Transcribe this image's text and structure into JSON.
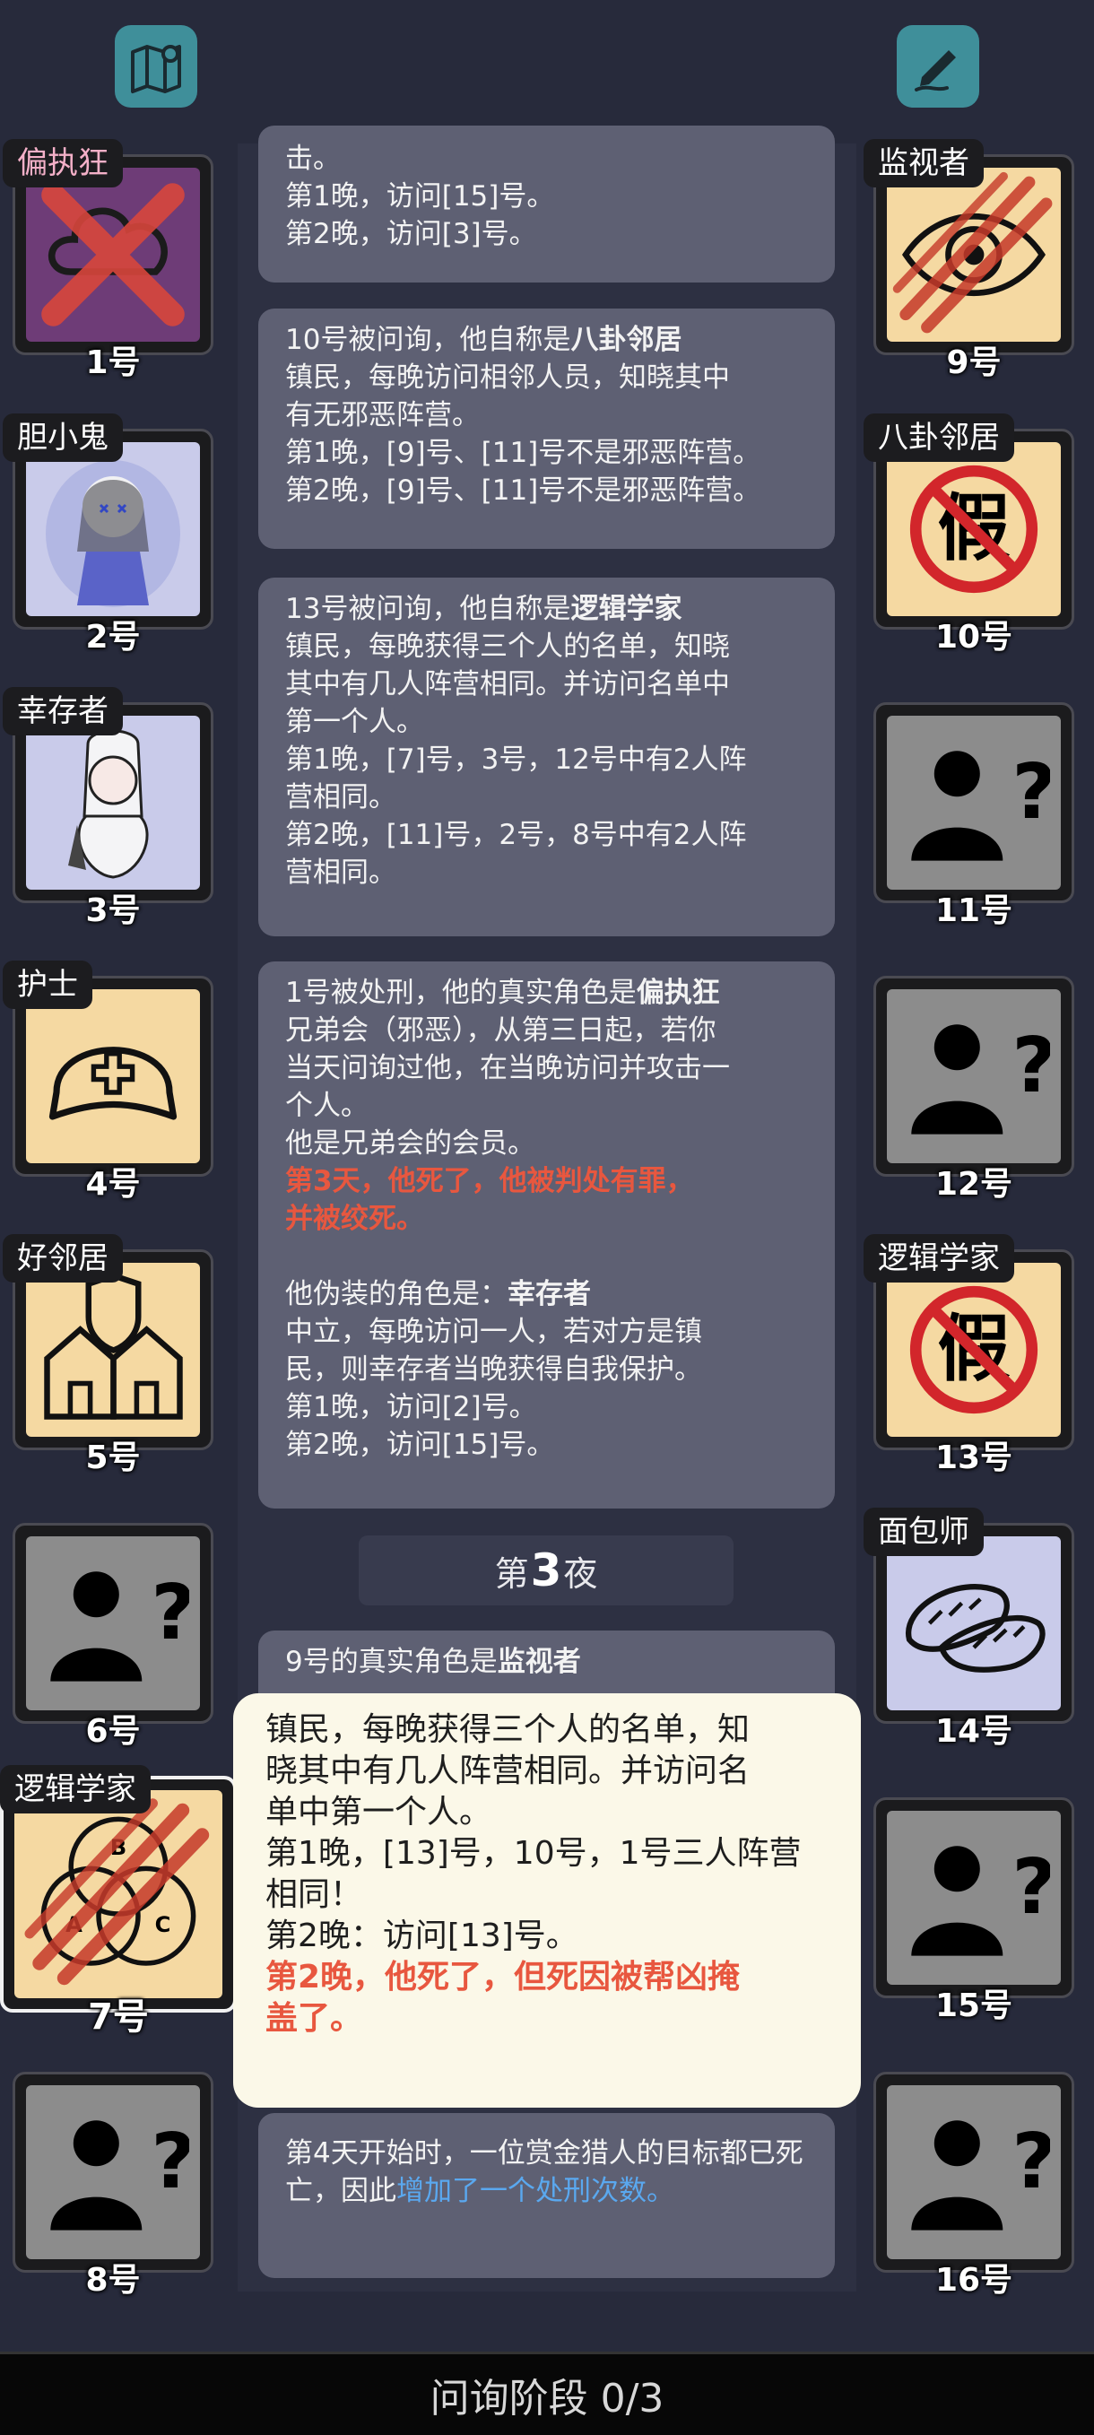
{
  "toolbar": {
    "map_icon": "map-icon",
    "notes_icon": "pen-note-icon"
  },
  "messages": {
    "m0": {
      "lines": [
        "击。",
        "第1晚，访问[15]号。",
        "第2晚，访问[3]号。"
      ]
    },
    "m1": {
      "prefix": "10号被问询，他自称是",
      "role": "八卦邻居",
      "lines": [
        "镇民，每晚访问相邻人员，知晓其中",
        "有无邪恶阵营。",
        "第1晚，[9]号、[11]号不是邪恶阵营。",
        "第2晚，[9]号、[11]号不是邪恶阵营。"
      ]
    },
    "m2": {
      "prefix": "13号被问询，他自称是",
      "role": "逻辑学家",
      "lines": [
        "镇民，每晚获得三个人的名单，知晓",
        "其中有几人阵营相同。并访问名单中",
        "第一个人。",
        "第1晚，[7]号，3号，12号中有2人阵",
        "营相同。",
        "第2晚，[11]号，2号，8号中有2人阵",
        "营相同。"
      ]
    },
    "m3": {
      "prefix": "1号被处刑，他的真实角色是",
      "role": "偏执狂",
      "lines": [
        "兄弟会（邪恶），从第三日起，若你",
        "当天问询过他，在当晚访问并攻击一",
        "个人。",
        "他是兄弟会的会员。"
      ],
      "red_lines": [
        "第3天，他死了，他被判处有罪，",
        "并被绞死。"
      ],
      "disguise_prefix": "他伪装的角色是：",
      "disguise_role": "幸存者",
      "lines2": [
        "中立，每晚访问一人，若对方是镇",
        "民，则幸存者当晚获得自我保护。",
        "第1晚，访问[2]号。",
        "第2晚，访问[15]号。"
      ]
    },
    "night": {
      "pre": "第",
      "num": "3",
      "post": "夜"
    },
    "m4": {
      "prefix": "9号的真实角色是",
      "role": "监视者"
    },
    "m5": {
      "text": "第4天开始时，一位赏金猎人的目标都已死亡，因此",
      "link": "增加了一个处刑次数。"
    }
  },
  "popup": {
    "lines": [
      "镇民，每晚获得三个人的名单，知",
      "晓其中有几人阵营相同。并访问名",
      "单中第一个人。",
      "第1晚，[13]号，10号，1号三人阵营",
      "相同！",
      "第2晚：访问[13]号。"
    ],
    "red_lines": [
      "第2晚，他死了，但死因被帮凶掩",
      "盖了。"
    ]
  },
  "players": {
    "p1": {
      "number": "1号",
      "role": "偏执狂",
      "icon": "paranoid-crossed-icon"
    },
    "p2": {
      "number": "2号",
      "role": "胆小鬼",
      "icon": "coward-avatar-icon"
    },
    "p3": {
      "number": "3号",
      "role": "幸存者",
      "icon": "survivor-avatar-icon"
    },
    "p4": {
      "number": "4号",
      "role": "护士",
      "icon": "nurse-cap-icon"
    },
    "p5": {
      "number": "5号",
      "role": "好邻居",
      "icon": "houses-shield-icon"
    },
    "p6": {
      "number": "6号",
      "role": "",
      "icon": "unknown-person-icon"
    },
    "p7": {
      "number": "7号",
      "role": "逻辑学家",
      "icon": "venn-diagram-icon"
    },
    "p8": {
      "number": "8号",
      "role": "",
      "icon": "unknown-person-icon"
    },
    "p9": {
      "number": "9号",
      "role": "监视者",
      "icon": "eye-icon"
    },
    "p10": {
      "number": "10号",
      "role": "八卦邻居",
      "icon": "fake-stamp-icon"
    },
    "p11": {
      "number": "11号",
      "role": "",
      "icon": "unknown-person-icon"
    },
    "p12": {
      "number": "12号",
      "role": "",
      "icon": "unknown-person-icon"
    },
    "p13": {
      "number": "13号",
      "role": "逻辑学家",
      "icon": "fake-stamp-icon"
    },
    "p14": {
      "number": "14号",
      "role": "面包师",
      "icon": "bread-icon"
    },
    "p15": {
      "number": "15号",
      "role": "",
      "icon": "unknown-person-icon"
    },
    "p16": {
      "number": "16号",
      "role": "",
      "icon": "unknown-person-icon"
    }
  },
  "fake_char": "假",
  "venn_letters": [
    "A",
    "B",
    "C"
  ],
  "phase": {
    "label": "问询阶段 0/3"
  }
}
